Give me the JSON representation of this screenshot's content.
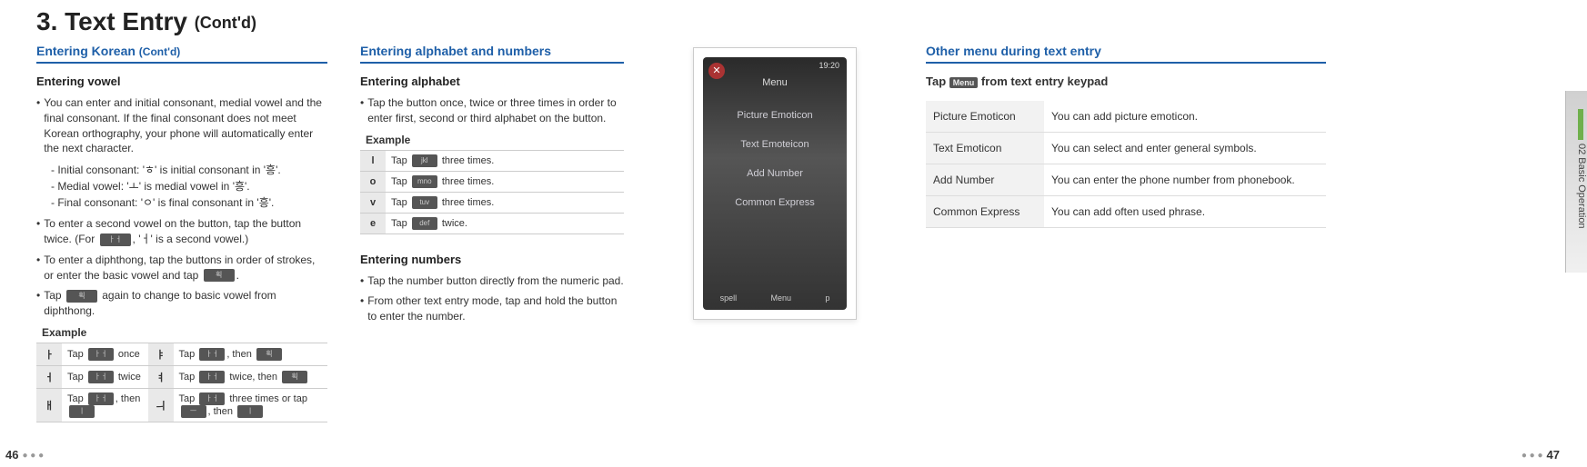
{
  "title_main": "3. Text Entry",
  "title_cont": "(Cont'd)",
  "col1_section": "Entering Korean",
  "col1_section_cont": "(Cont'd)",
  "col1_sub": "Entering vowel",
  "c1_b1": "You can enter and initial consonant, medial vowel and the final consonant. If the final consonant does not meet Korean orthography, your phone will automatically enter the next character.",
  "c1_i1": "- Initial consonant: 'ㅎ' is initial consonant in '흥'.",
  "c1_i2": "- Medial vowel: 'ㅗ' is medial vowel in '흥'.",
  "c1_i3": "- Final consonant: 'ㅇ' is final consonant in '흥'.",
  "c1_b2a": "To enter a second vowel on the button, tap the button twice. (For ",
  "c1_b2b": ", 'ㅓ' is a second vowel.)",
  "c1_b3a": "To enter a diphthong, tap the buttons in order of strokes, or enter the basic vowel and tap ",
  "c1_b3b": ".",
  "c1_b4a": "Tap ",
  "c1_b4b": " again to change to basic vowel from diphthong.",
  "example_label": "Example",
  "ex1": {
    "r1a": "ㅏ",
    "r1b_1": "Tap ",
    "r1b_2": " once",
    "r1c": "ㅑ",
    "r1d_1": "Tap ",
    "r1d_2": ", then ",
    "r2a": "ㅓ",
    "r2b_1": "Tap ",
    "r2b_2": " twice",
    "r2c": "ㅕ",
    "r2d_1": "Tap ",
    "r2d_2": " twice, then ",
    "r3a": "ㅐ",
    "r3b_1": "Tap ",
    "r3b_2": ", then ",
    "r3c": "ㅢ",
    "r3d_1": "Tap ",
    "r3d_2": " three times or tap ",
    "r3d_3": ", then "
  },
  "col2_section": "Entering alphabet and numbers",
  "col2_sub1": "Entering alphabet",
  "c2_b1": "Tap the button once, twice or three times in order to enter first, second or third alphabet on the button.",
  "ex2": {
    "r1a": "l",
    "r1b_1": "Tap ",
    "r1b_2": " three times.",
    "r2a": "o",
    "r2b_1": "Tap ",
    "r2b_2": " three times.",
    "r3a": "v",
    "r3b_1": "Tap ",
    "r3b_2": " three times.",
    "r4a": "e",
    "r4b_1": "Tap ",
    "r4b_2": " twice."
  },
  "col2_sub2": "Entering numbers",
  "c2_b2": "Tap the number button directly from the numeric pad.",
  "c2_b3": "From other text entry mode, tap and hold the button to enter the number.",
  "phone_status": "19:20",
  "phone_title": "Menu",
  "phone_m1": "Picture Emoticon",
  "phone_m2": "Text Emoteicon",
  "phone_m3": "Add Number",
  "phone_m4": "Common Express",
  "phone_b1": "spell",
  "phone_b2": "Menu",
  "phone_b3": "p",
  "col4_section": "Other menu during text entry",
  "c4_line_a": "Tap ",
  "c4_line_b": " from text entry keypad",
  "menu_btn": "Menu",
  "menu": {
    "r1a": "Picture Emoticon",
    "r1b": "You can add picture emoticon.",
    "r2a": "Text Emoticon",
    "r2b": "You can select and enter general symbols.",
    "r3a": "Add Number",
    "r3b": "You can enter the phone number from phonebook.",
    "r4a": "Common Express",
    "r4b": "You can add often used phrase."
  },
  "side_tab": "02 Basic Operation",
  "page_left": "46",
  "page_right": "47"
}
